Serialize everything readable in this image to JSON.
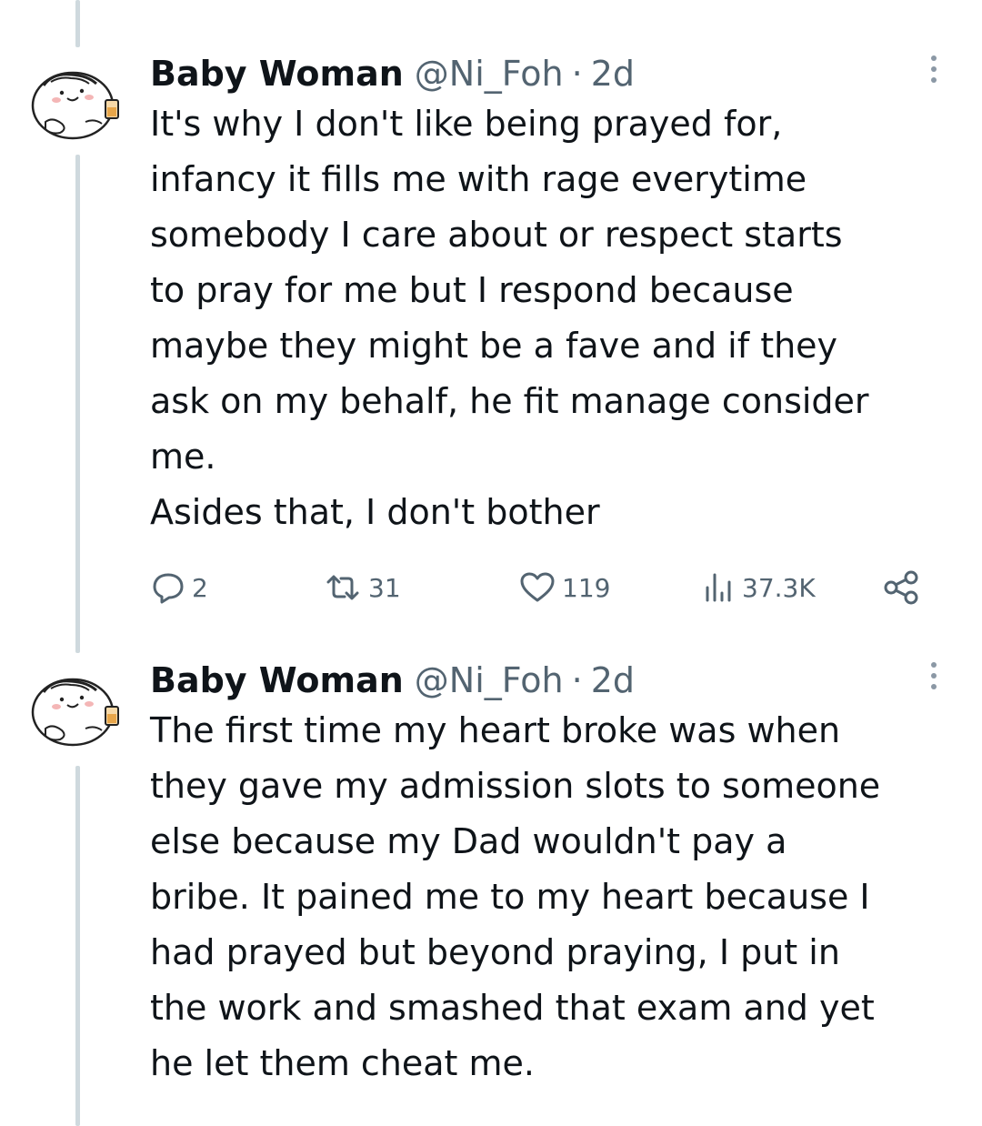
{
  "tweets": [
    {
      "author_name": "Baby Woman",
      "handle": "@Ni_Foh",
      "separator": "·",
      "time": "2d",
      "text": "It's why I don't like being prayed for,\ninfancy it fills me with rage everytime\nsomebody I care about or respect starts\nto pray for me but I respond because\nmaybe they might be a fave and if they\nask on my behalf, he fit manage consider\nme.\nAsides that, I don't bother",
      "stats": {
        "replies": "2",
        "reposts": "31",
        "likes": "119",
        "views": "37.3K"
      },
      "icons": [
        "reply-icon",
        "repost-icon",
        "like-icon",
        "views-icon",
        "share-icon"
      ]
    },
    {
      "author_name": "Baby Woman",
      "handle": "@Ni_Foh",
      "separator": "·",
      "time": "2d",
      "text": "The first time my heart broke was when\nthey gave my admission slots to someone\nelse because my Dad wouldn't pay a\nbribe. It pained me to my heart because I\nhad prayed but beyond praying, I put in\nthe work and smashed that exam and yet\nhe let them cheat me."
    }
  ],
  "colors": {
    "text_primary": "#0f1419",
    "text_secondary": "#536471",
    "thread_line": "#cfd9de",
    "background": "#ffffff"
  }
}
